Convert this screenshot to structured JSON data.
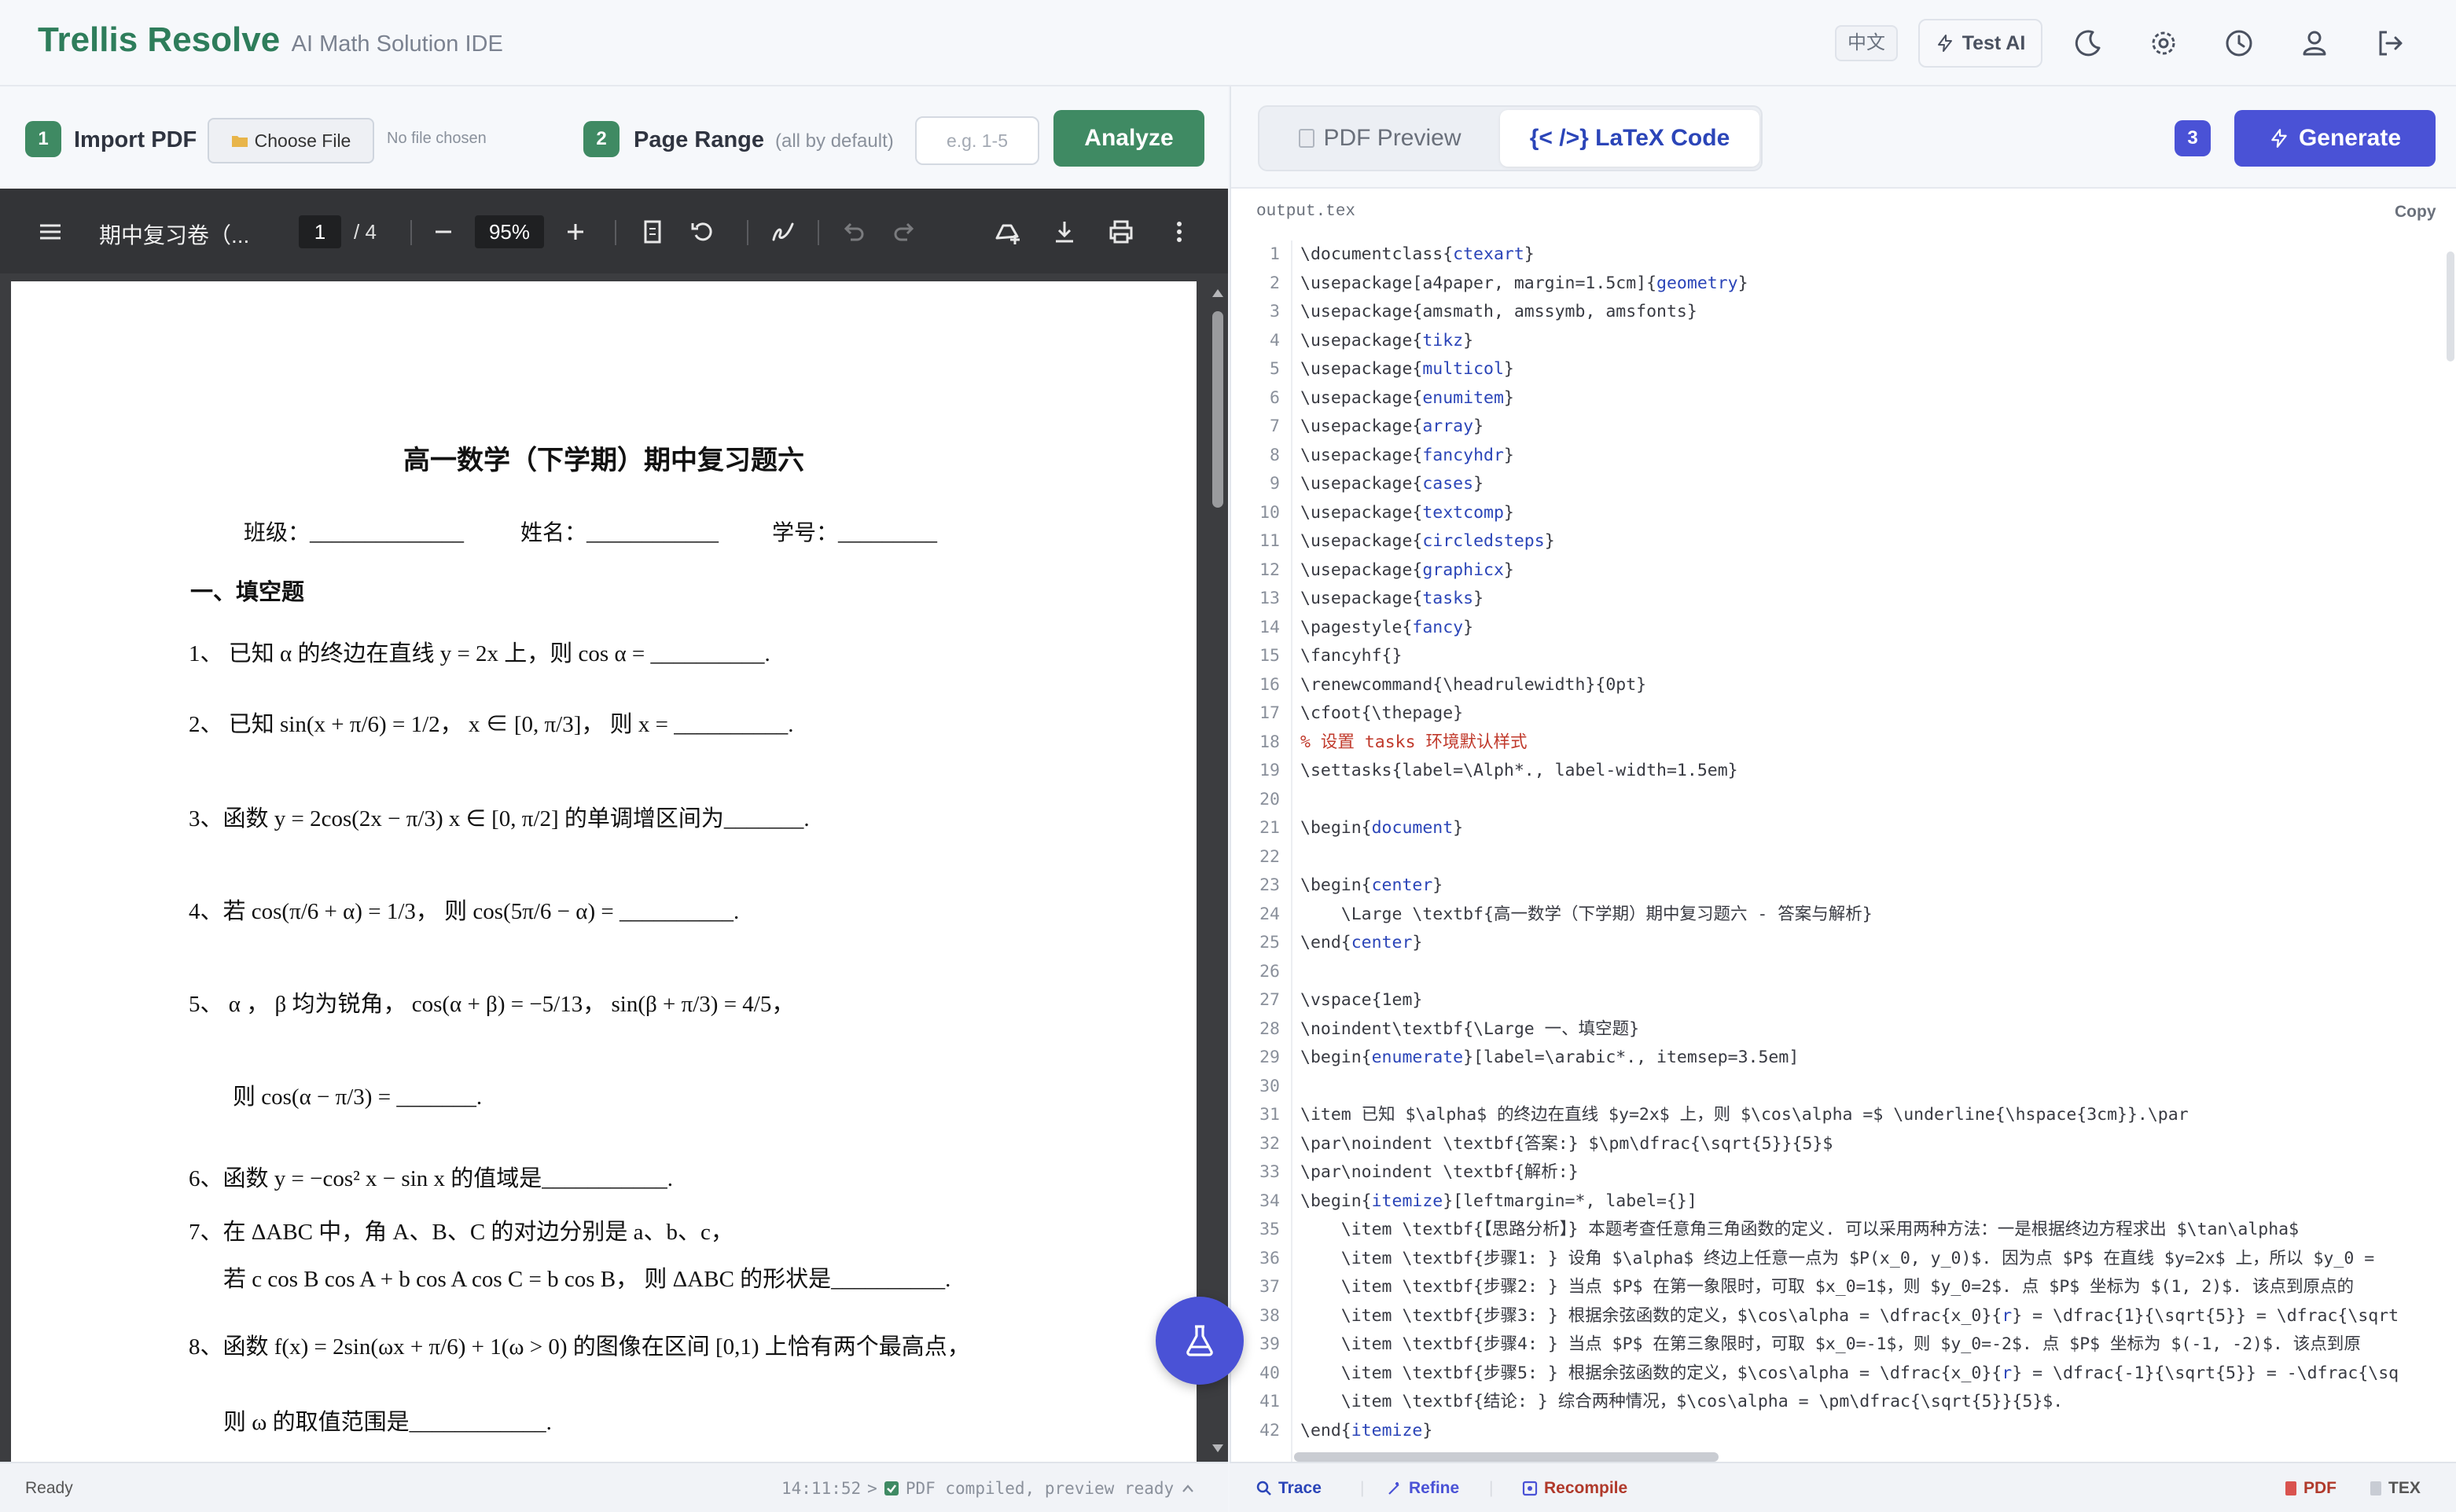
{
  "app": {
    "name": "Trellis Resolve",
    "subtitle": "AI Math Solution IDE"
  },
  "header": {
    "lang_label": "中文",
    "test_ai_label": "Test AI",
    "icons": [
      "moon-icon",
      "gear-icon",
      "history-icon",
      "users-icon",
      "logout-icon"
    ]
  },
  "controls": {
    "step1": "1",
    "import_label": "Import PDF",
    "choose_file_label": "Choose File",
    "no_file": "No file chosen",
    "step2": "2",
    "page_range_label": "Page Range",
    "page_range_hint": "(all by default)",
    "page_range_placeholder": "e.g. 1-5",
    "analyze_label": "Analyze"
  },
  "viewer": {
    "title": "期中复习卷（...",
    "current_page": "1",
    "total_pages": "/ 4",
    "zoom": "95%"
  },
  "pdf": {
    "title": "高一数学（下学期）期中复习题六",
    "class_line": "班级：______________",
    "name_line": "姓名：____________",
    "id_line": "学号：_________",
    "section": "一、填空题",
    "q1": "1、 已知 α 的终边在直线 y = 2x 上，则 cos α = __________.",
    "q2": "2、 已知 sin(x + π/6) = 1/2， x ∈ [0, π/3]， 则 x = __________.",
    "q3": "3、函数 y = 2cos(2x − π/3)  x ∈ [0, π/2] 的单调增区间为_______.",
    "q4": "4、若 cos(π/6 + α) = 1/3， 则 cos(5π/6 − α) = __________.",
    "q5": "5、 α ， β 均为锐角， cos(α + β) = −5/13， sin(β + π/3) = 4/5，",
    "q5b": "则 cos(α − π/3) = _______.",
    "q6": "6、函数 y = −cos² x − sin x 的值域是___________.",
    "q7": "7、在 ΔABC 中，角 A、B、C 的对边分别是 a、b、c，",
    "q7b": "若 c cos B cos A + b cos A cos C = b cos B， 则 ΔABC 的形状是__________.",
    "q8": "8、函数 f(x) = 2sin(ωx + π/6) + 1(ω > 0) 的图像在区间 [0,1) 上恰有两个最高点，",
    "q8b": "则 ω 的取值范围是____________."
  },
  "right_panel": {
    "tab_pdf": "PDF Preview",
    "tab_latex": "{< />} LaTeX Code",
    "step3": "3",
    "generate_label": "Generate",
    "file_name": "output.tex",
    "copy_label": "Copy"
  },
  "code_lines": [
    "\\documentclass{ctexart}",
    "\\usepackage[a4paper, margin=1.5cm]{geometry}",
    "\\usepackage{amsmath, amssymb, amsfonts}",
    "\\usepackage{tikz}",
    "\\usepackage{multicol}",
    "\\usepackage{enumitem}",
    "\\usepackage{array}",
    "\\usepackage{fancyhdr}",
    "\\usepackage{cases}",
    "\\usepackage{textcomp}",
    "\\usepackage{circledsteps}",
    "\\usepackage{graphicx}",
    "\\usepackage{tasks}",
    "\\pagestyle{fancy}",
    "\\fancyhf{}",
    "\\renewcommand{\\headrulewidth}{0pt}",
    "\\cfoot{\\thepage}",
    "% 设置 tasks 环境默认样式",
    "\\settasks{label=\\Alph*., label-width=1.5em}",
    "",
    "\\begin{document}",
    "",
    "\\begin{center}",
    "    \\Large \\textbf{高一数学（下学期）期中复习题六 - 答案与解析}",
    "\\end{center}",
    "",
    "\\vspace{1em}",
    "\\noindent\\textbf{\\Large 一、填空题}",
    "\\begin{enumerate}[label=\\arabic*., itemsep=3.5em]",
    "",
    "\\item 已知 $\\alpha$ 的终边在直线 $y=2x$ 上，则 $\\cos\\alpha =$ \\underline{\\hspace{3cm}}.\\par",
    "\\par\\noindent \\textbf{答案:} $\\pm\\dfrac{\\sqrt{5}}{5}$",
    "\\par\\noindent \\textbf{解析:}",
    "\\begin{itemize}[leftmargin=*, label={}]",
    "    \\item \\textbf{【思路分析】} 本题考查任意角三角函数的定义. 可以采用两种方法：一是根据终边方程求出 $\\tan\\alpha$",
    "    \\item \\textbf{步骤1: } 设角 $\\alpha$ 终边上任意一点为 $P(x_0, y_0)$. 因为点 $P$ 在直线 $y=2x$ 上，所以 $y_0 =",
    "    \\item \\textbf{步骤2: } 当点 $P$ 在第一象限时，可取 $x_0=1$，则 $y_0=2$. 点 $P$ 坐标为 $(1, 2)$. 该点到原点的",
    "    \\item \\textbf{步骤3: } 根据余弦函数的定义，$\\cos\\alpha = \\dfrac{x_0}{r} = \\dfrac{1}{\\sqrt{5}} = \\dfrac{\\sqrt",
    "    \\item \\textbf{步骤4: } 当点 $P$ 在第三象限时，可取 $x_0=-1$，则 $y_0=-2$. 点 $P$ 坐标为 $(-1, -2)$. 该点到原",
    "    \\item \\textbf{步骤5: } 根据余弦函数的定义，$\\cos\\alpha = \\dfrac{x_0}{r} = \\dfrac{-1}{\\sqrt{5}} = -\\dfrac{\\sq",
    "    \\item \\textbf{结论: } 综合两种情况，$\\cos\\alpha = \\pm\\dfrac{\\sqrt{5}}{5}$.",
    "\\end{itemize}"
  ],
  "status": {
    "ready": "Ready",
    "time": "14:11:52",
    "sep": ">",
    "message": "PDF compiled, preview ready",
    "trace": "Trace",
    "refine": "Refine",
    "recompile": "Recompile",
    "pdf_link": "PDF",
    "tex_link": "TEX"
  },
  "colors": {
    "brand_green": "#2e7d5b",
    "accent_purple": "#4a52d6",
    "latex_blue": "#2b45b8",
    "comment_red": "#c0392b"
  }
}
